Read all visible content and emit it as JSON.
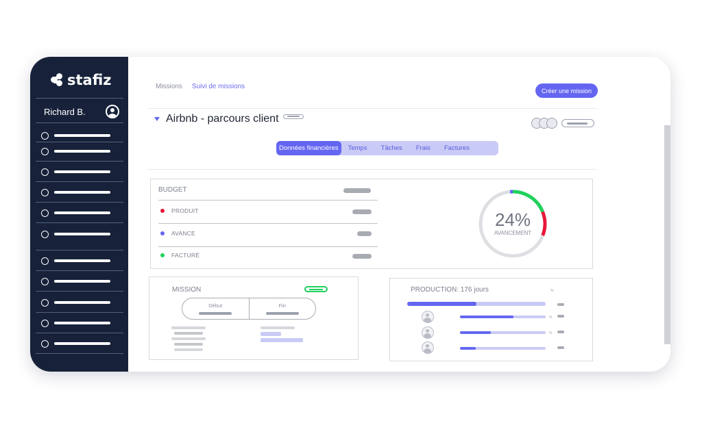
{
  "brand": {
    "name": "stafiz"
  },
  "user": {
    "name": "Richard B."
  },
  "breadcrumb": {
    "parent": "Missions",
    "current": "Suivi de missions"
  },
  "actions": {
    "create_label": "Créer une mission"
  },
  "project": {
    "title": "Airbnb - parcours client"
  },
  "tabs": [
    {
      "label": "Données financières",
      "active": true
    },
    {
      "label": "Temps"
    },
    {
      "label": "Tâches"
    },
    {
      "label": "Frais"
    },
    {
      "label": "Factures"
    }
  ],
  "budget": {
    "title": "BUDGET",
    "rows": [
      {
        "label": "PRODUIT",
        "color": "#e8163a"
      },
      {
        "label": "AVANCE",
        "color": "#6466f1"
      },
      {
        "label": "FACTURÉ",
        "color": "#1fd15b"
      }
    ]
  },
  "progress": {
    "value": "24%",
    "label": "AVANCEMENT",
    "fraction": 0.24
  },
  "mission": {
    "title": "MISSION",
    "start_label": "Début",
    "end_label": "Fin"
  },
  "production": {
    "title": "PRODUCTION: 176 jours",
    "total_fill": 0.5,
    "members": [
      0.62,
      0.36,
      0.18
    ],
    "pct_symbol": "%"
  },
  "colors": {
    "accent": "#6466f1",
    "sidebar": "#17223a",
    "green": "#1fd15b",
    "red": "#e8163a"
  }
}
